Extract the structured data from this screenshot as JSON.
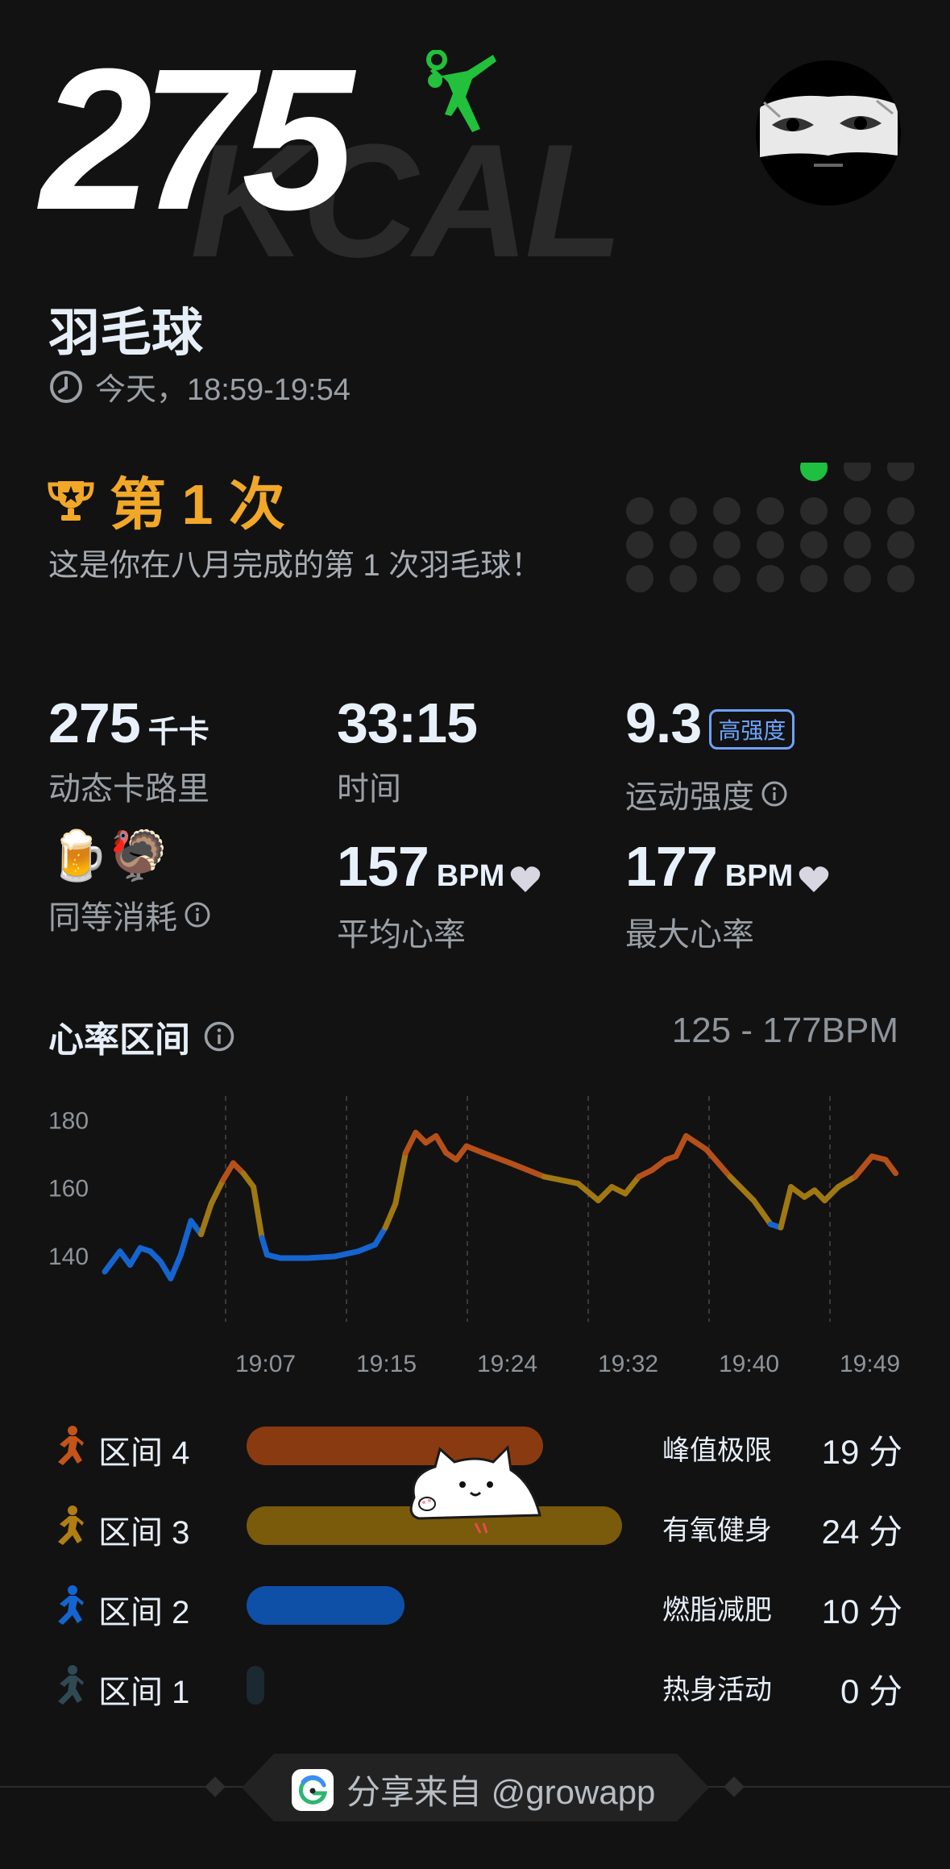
{
  "header": {
    "calories": "275",
    "bg_unit": "KCAL",
    "sport_icon": "badminton-player-icon",
    "avatar": "user-avatar"
  },
  "activity": {
    "name": "羽毛球",
    "time_text": "今天，18:59-19:54"
  },
  "achievement": {
    "title": "第 1 次",
    "description": "这是你在八月完成的第 1 次羽毛球！",
    "dot_grid": {
      "rows": 4,
      "cols": 7,
      "active_count": 1,
      "active_color": "#1fbf3f"
    }
  },
  "stats": {
    "calories": {
      "value": "275",
      "unit": "千卡",
      "label": "动态卡路里"
    },
    "duration": {
      "value": "33:15",
      "label": "时间"
    },
    "intensity": {
      "value": "9.3",
      "badge": "高强度",
      "label": "运动强度"
    },
    "equivalent": {
      "icons": "🍺🦃",
      "label": "同等消耗"
    },
    "avg_hr": {
      "value": "157",
      "unit": "BPM",
      "label": "平均心率"
    },
    "max_hr": {
      "value": "177",
      "unit": "BPM",
      "label": "最大心率"
    }
  },
  "hr_section": {
    "title": "心率区间",
    "range": "125 - 177BPM"
  },
  "chart_data": {
    "type": "line",
    "y_ticks": [
      180,
      160,
      140
    ],
    "x_ticks": [
      "19:07",
      "19:15",
      "19:24",
      "19:32",
      "19:40",
      "19:49"
    ],
    "ylim": [
      125,
      182
    ],
    "grid": "vertical dashed",
    "series": [
      {
        "values": [
          [
            0,
            135
          ],
          [
            0.15,
            137
          ],
          [
            0.45,
            141
          ],
          [
            0.75,
            137
          ],
          [
            1.05,
            142
          ],
          [
            1.35,
            141
          ],
          [
            1.65,
            138
          ],
          [
            1.95,
            133
          ],
          [
            2.25,
            140
          ],
          [
            2.55,
            150
          ],
          [
            2.85,
            146
          ],
          [
            3.15,
            155
          ],
          [
            3.5,
            162
          ],
          [
            3.8,
            167
          ],
          [
            4.1,
            164
          ],
          [
            4.4,
            160
          ],
          [
            4.65,
            145
          ],
          [
            4.8,
            140
          ],
          [
            5.2,
            139
          ],
          [
            6.0,
            139
          ],
          [
            6.8,
            139.5
          ],
          [
            7.5,
            141
          ],
          [
            8.0,
            143
          ],
          [
            8.3,
            148
          ],
          [
            8.6,
            155
          ],
          [
            8.9,
            170
          ],
          [
            9.2,
            176
          ],
          [
            9.5,
            173
          ],
          [
            9.8,
            175
          ],
          [
            10.1,
            170
          ],
          [
            10.4,
            168
          ],
          [
            10.7,
            172
          ],
          [
            11.2,
            170
          ],
          [
            12.0,
            167
          ],
          [
            13.0,
            163
          ],
          [
            14.0,
            161
          ],
          [
            14.6,
            156
          ],
          [
            15.0,
            160
          ],
          [
            15.4,
            158
          ],
          [
            15.8,
            163
          ],
          [
            16.2,
            165
          ],
          [
            16.6,
            168
          ],
          [
            16.9,
            169
          ],
          [
            17.2,
            175
          ],
          [
            17.5,
            173
          ],
          [
            17.8,
            171
          ],
          [
            18.5,
            163
          ],
          [
            19.2,
            156
          ],
          [
            19.7,
            149
          ],
          [
            20.0,
            148
          ],
          [
            20.3,
            160
          ],
          [
            20.7,
            157
          ],
          [
            21.0,
            159
          ],
          [
            21.3,
            156
          ],
          [
            21.7,
            160
          ],
          [
            22.2,
            163
          ],
          [
            22.7,
            169
          ],
          [
            23.1,
            168
          ],
          [
            23.4,
            164
          ]
        ]
      }
    ]
  },
  "zones": [
    {
      "name": "区间 4",
      "fraction": 0.79,
      "color": "#8a3a10",
      "icon_color": "#c4541a",
      "desc": "峰值极限",
      "minutes": "19 分"
    },
    {
      "name": "区间 3",
      "fraction": 1.0,
      "color": "#7a5a0b",
      "icon_color": "#b07e12",
      "desc": "有氧健身",
      "minutes": "24 分"
    },
    {
      "name": "区间 2",
      "fraction": 0.42,
      "color": "#0e4fa8",
      "icon_color": "#1565d0",
      "desc": "燃脂减肥",
      "minutes": "10 分"
    },
    {
      "name": "区间 1",
      "fraction": 0.0,
      "color": "#1a2a30",
      "icon_color": "#2f4a55",
      "desc": "热身活动",
      "minutes": "0 分"
    }
  ],
  "footer": {
    "share_text": "分享来自 @growapp",
    "logo": "grow-app-logo"
  }
}
